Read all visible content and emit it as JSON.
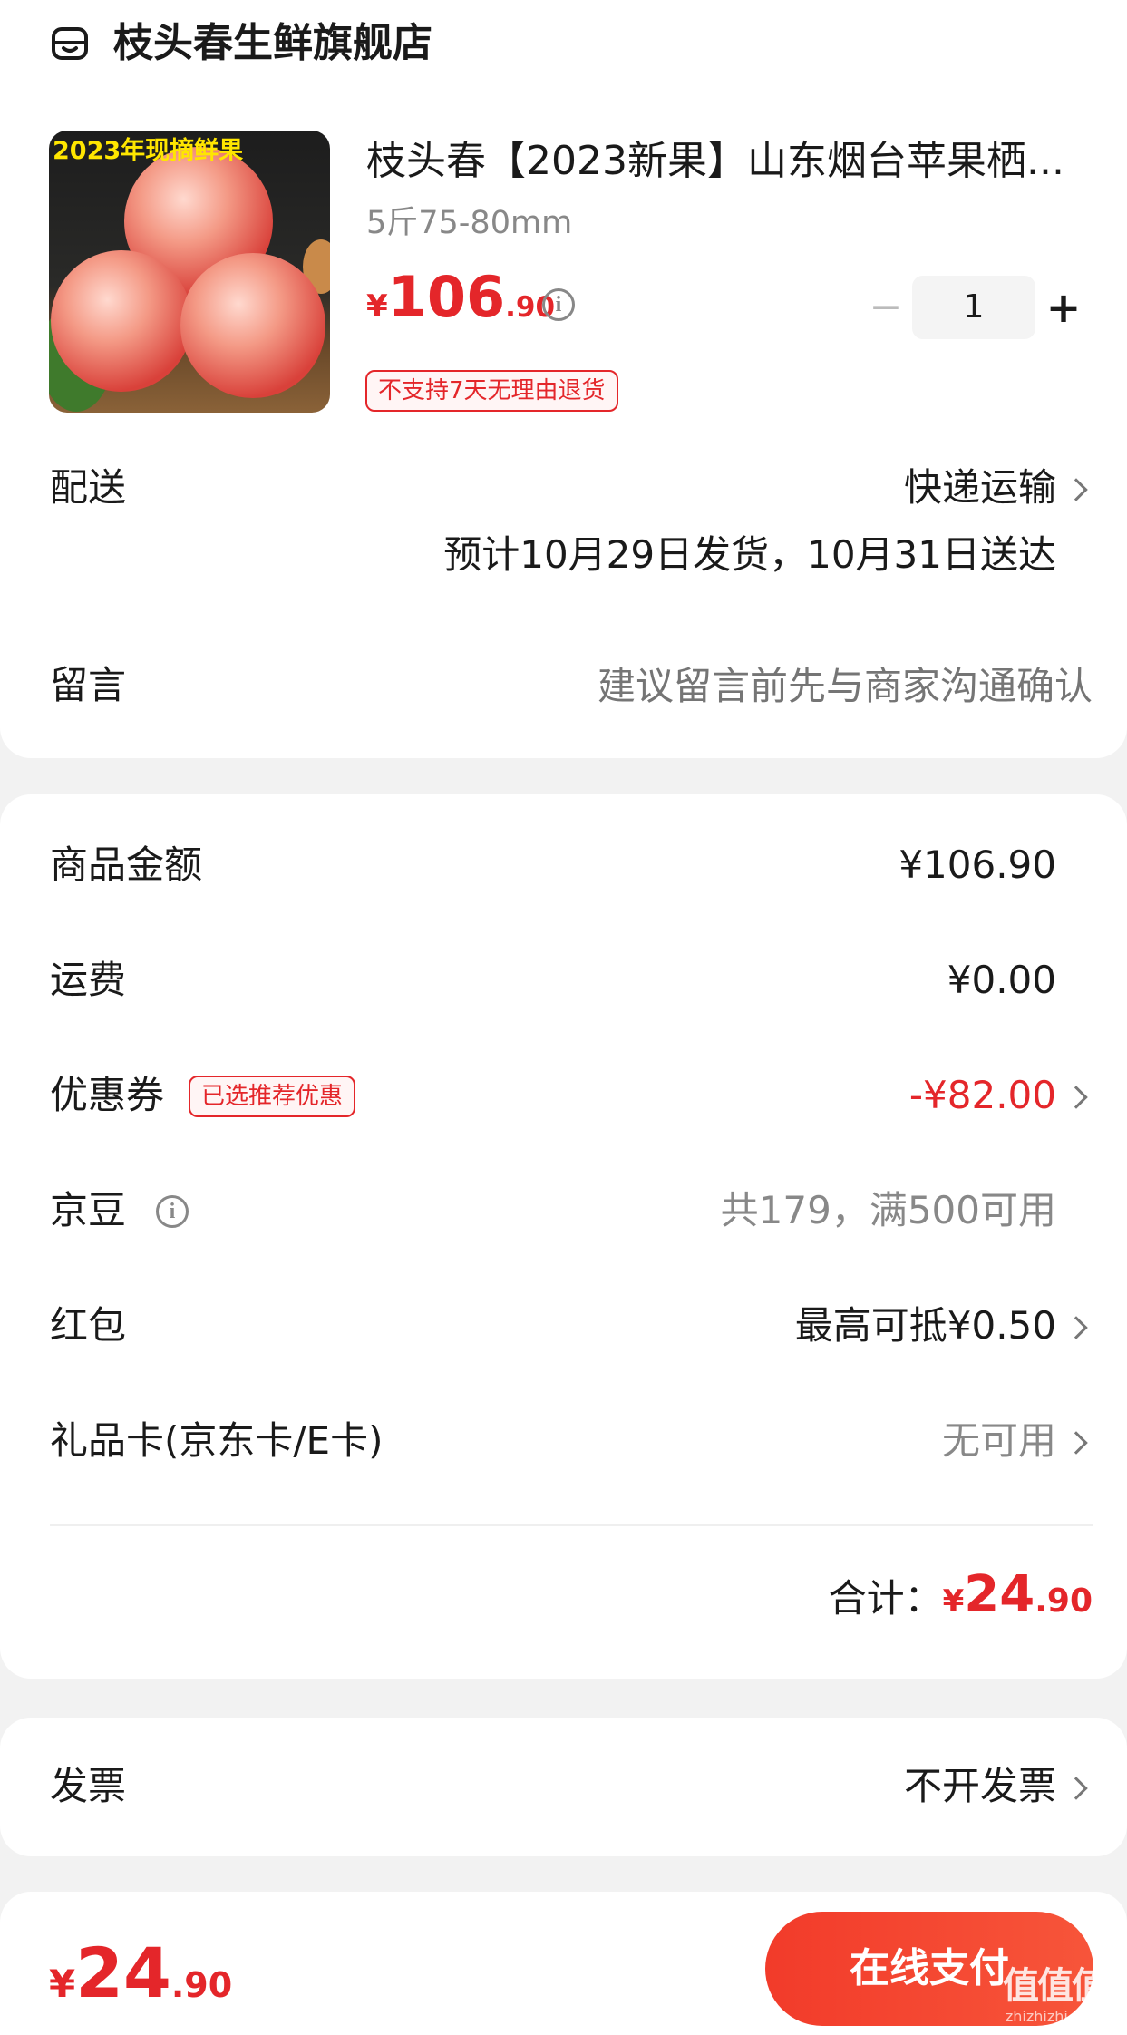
{
  "store": {
    "name": "枝头春生鲜旗舰店",
    "icon": "store-icon"
  },
  "product": {
    "image_caption": "2023年现摘鲜果",
    "title": "枝头春【2023新果】山东烟台苹果栖...",
    "spec": "5斤75-80mm",
    "price_currency": "¥",
    "price_int": "106",
    "price_dec": ".90",
    "quantity": "1",
    "minus": "−",
    "plus": "+",
    "return_tag": "不支持7天无理由退货"
  },
  "delivery": {
    "label": "配送",
    "method": "快递运输",
    "estimate": "预计10月29日发货，10月31日送达"
  },
  "message": {
    "label": "留言",
    "placeholder": "建议留言前先与商家沟通确认"
  },
  "summary": {
    "goods": {
      "label": "商品金额",
      "value": "¥106.90"
    },
    "shipping": {
      "label": "运费",
      "value": "¥0.00"
    },
    "coupon": {
      "label": "优惠券",
      "tag": "已选推荐优惠",
      "value": "-¥82.00"
    },
    "jingdou": {
      "label": "京豆",
      "value": "共179，满500可用"
    },
    "redpacket": {
      "label": "红包",
      "value": "最高可抵¥0.50"
    },
    "giftcard": {
      "label": "礼品卡(京东卡/E卡)",
      "value": "无可用"
    },
    "total_label": "合计：",
    "total_currency": "¥",
    "total_int": "24",
    "total_dec": ".90"
  },
  "invoice": {
    "label": "发票",
    "value": "不开发票"
  },
  "footer": {
    "currency": "¥",
    "amount_int": "24",
    "amount_dec": ".90",
    "pay_button": "在线支付"
  },
  "watermark": {
    "text": "值值值",
    "site": "zhizhizhi.com"
  },
  "colors": {
    "accent": "#e4262a",
    "pay_gradient_start": "#f23b2a",
    "pay_gradient_end": "#f7553a",
    "background": "#f2f2f2"
  }
}
